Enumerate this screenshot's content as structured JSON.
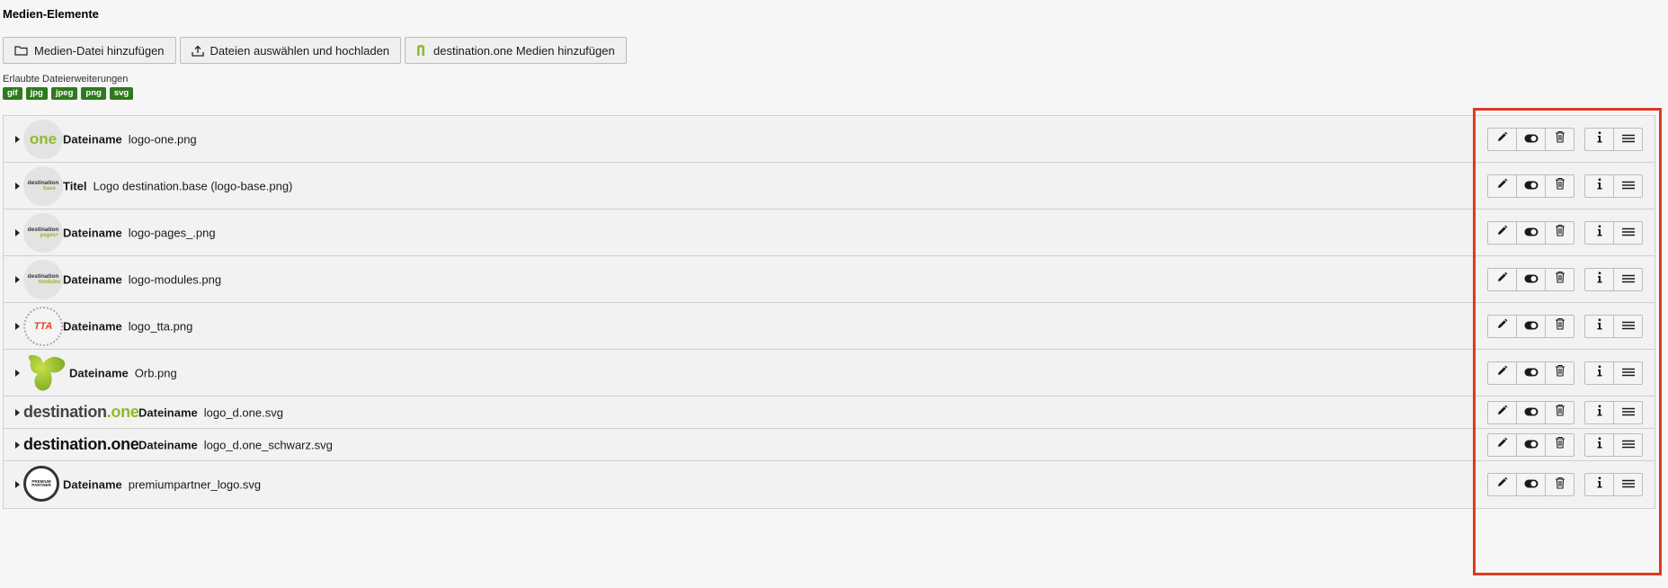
{
  "section_title": "Medien-Elemente",
  "toolbar": {
    "add_media_label": "Medien-Datei hinzufügen",
    "upload_label": "Dateien auswählen und hochladen",
    "destination_label": "destination.one Medien hinzufügen"
  },
  "allowed": {
    "label": "Erlaubte Dateierweiterungen",
    "extensions": [
      "gif",
      "jpg",
      "jpeg",
      "png",
      "svg"
    ]
  },
  "rows": [
    {
      "key": "Dateiname",
      "value": "logo-one.png",
      "thumb_text": "one"
    },
    {
      "key": "Titel",
      "value": "Logo destination.base (logo-base.png)",
      "thumb_text": "destination",
      "thumb_sub": "base"
    },
    {
      "key": "Dateiname",
      "value": "logo-pages_.png",
      "thumb_text": "destination",
      "thumb_sub": "pages+"
    },
    {
      "key": "Dateiname",
      "value": "logo-modules.png",
      "thumb_text": "destination",
      "thumb_sub": "modules"
    },
    {
      "key": "Dateiname",
      "value": "logo_tta.png",
      "thumb_text": "TTA"
    },
    {
      "key": "Dateiname",
      "value": "Orb.png"
    },
    {
      "key": "Dateiname",
      "value": "logo_d.one.svg",
      "thumb_text": "destination",
      "thumb_sub": ".one"
    },
    {
      "key": "Dateiname",
      "value": "logo_d.one_schwarz.svg",
      "thumb_text": "destination.one"
    },
    {
      "key": "Dateiname",
      "value": "premiumpartner_logo.svg",
      "thumb_text": "PREMIUM",
      "thumb_sub": "PARTNER"
    }
  ],
  "actions": {
    "icons": [
      "pencil-icon",
      "toggle-icon",
      "trash-icon",
      "info-icon",
      "drag-handle-icon"
    ]
  },
  "colors": {
    "extension_badge": "#2e7a1c",
    "brand_green": "#8fba2a",
    "highlight": "#dd3a22"
  }
}
